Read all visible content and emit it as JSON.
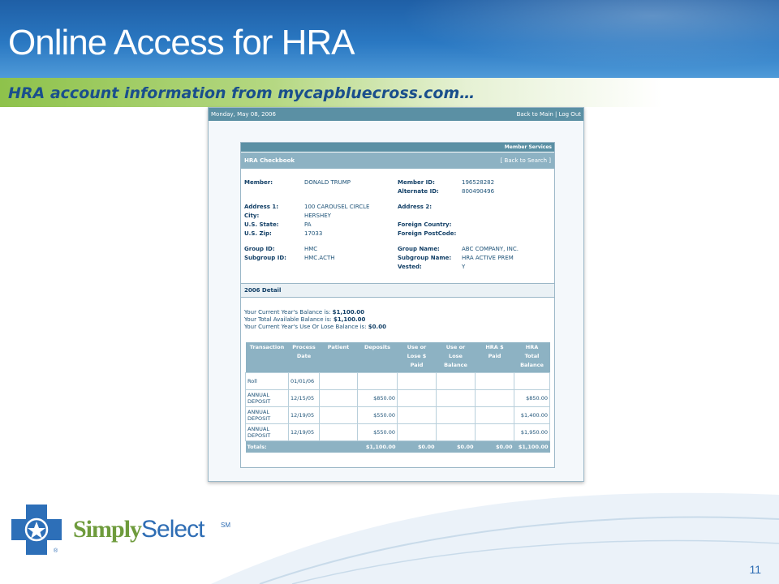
{
  "slide": {
    "title": "Online Access for HRA",
    "subtitle": "HRA account information from mycapbluecross.com…",
    "page_number": "11"
  },
  "screenshot": {
    "date": "Monday, May 08, 2006",
    "links": [
      "Back to Main",
      "Log Out"
    ],
    "member_services": "Member Services",
    "section_title": "HRA Checkbook",
    "back_to_search": "[ Back to Search ]",
    "fields": {
      "member": {
        "label": "Member:",
        "value": "DONALD TRUMP"
      },
      "member_id": {
        "label": "Member ID:",
        "value": "196528282"
      },
      "alternate_id": {
        "label": "Alternate ID:",
        "value": "800490496"
      },
      "address1": {
        "label": "Address 1:",
        "value": "100 CAROUSEL CIRCLE"
      },
      "address2": {
        "label": "Address 2:",
        "value": ""
      },
      "city": {
        "label": "City:",
        "value": "HERSHEY"
      },
      "state": {
        "label": "U.S. State:",
        "value": "PA"
      },
      "foreign_country": {
        "label": "Foreign Country:",
        "value": ""
      },
      "zip": {
        "label": "U.S. Zip:",
        "value": "17033"
      },
      "foreign_postcode": {
        "label": "Foreign PostCode:",
        "value": ""
      },
      "group_id": {
        "label": "Group ID:",
        "value": "HMC"
      },
      "group_name": {
        "label": "Group Name:",
        "value": "ABC COMPANY, INC."
      },
      "subgroup_id": {
        "label": "Subgroup ID:",
        "value": "HMC.ACTH"
      },
      "subgroup_name": {
        "label": "Subgroup Name:",
        "value": "HRA ACTIVE PREM"
      },
      "vested": {
        "label": "Vested:",
        "value": "Y"
      }
    },
    "detail_title": "2006 Detail",
    "balances": [
      {
        "text": "Your Current Year's Balance is:",
        "amount": "$1,100.00"
      },
      {
        "text": "Your Total Available Balance is:",
        "amount": "$1,100.00"
      },
      {
        "text": "Your Current Year's Use Or Lose Balance is:",
        "amount": "$0.00"
      }
    ],
    "table": {
      "headers": [
        [
          "Transaction"
        ],
        [
          "Process",
          "Date"
        ],
        [
          "Patient"
        ],
        [
          "Deposits"
        ],
        [
          "Use or",
          "Lose $",
          "Paid"
        ],
        [
          "Use or",
          "Lose",
          "Balance"
        ],
        [
          "HRA $",
          "Paid"
        ],
        [
          "HRA",
          "Total",
          "Balance"
        ]
      ],
      "rows": [
        [
          "Roll",
          "01/01/06",
          "",
          "",
          "",
          "",
          "",
          ""
        ],
        [
          "ANNUAL DEPOSIT",
          "12/15/05",
          "",
          "$850.00",
          "",
          "",
          "",
          "$850.00"
        ],
        [
          "ANNUAL DEPOSIT",
          "12/19/05",
          "",
          "$550.00",
          "",
          "",
          "",
          "$1,400.00"
        ],
        [
          "ANNUAL DEPOSIT",
          "12/19/05",
          "",
          "$550.00",
          "",
          "",
          "",
          "$1,950.00"
        ]
      ],
      "totals": [
        "Totals:",
        "",
        "",
        "$1,100.00",
        "$0.00",
        "$0.00",
        "$0.00",
        "$1,100.00"
      ]
    }
  },
  "logo": {
    "brand_part1": "Simply",
    "brand_part2": "Select",
    "brand_mark": "SM",
    "registered": "®"
  },
  "colors": {
    "banner_blue": "#2a78c2",
    "subbar_green": "#8ec24b",
    "table_header": "#8db2c3",
    "brand_green": "#6e9b3c",
    "brand_blue": "#2e6db4"
  }
}
